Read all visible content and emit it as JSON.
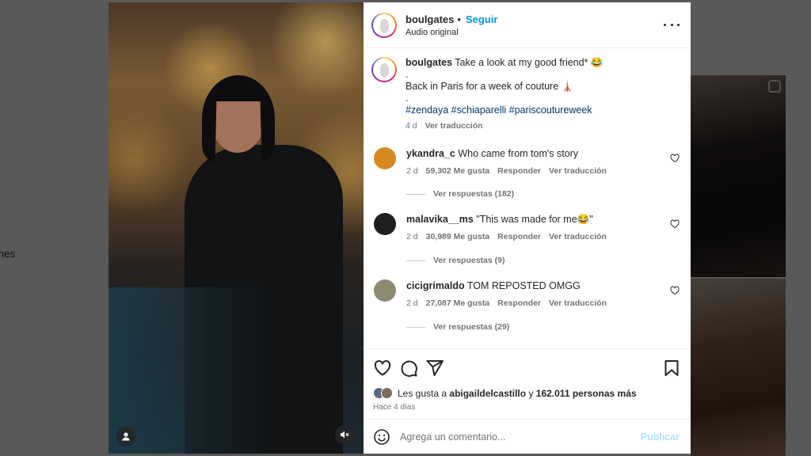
{
  "background": {
    "side_text": "nes"
  },
  "post": {
    "username": "boulgates",
    "separator": "•",
    "follow_label": "Seguir",
    "audio": "Audio original",
    "caption": {
      "username": "boulgates",
      "text_line1": "Take a look at my good friend* 😂",
      "line2": ".",
      "line3": "Back in Paris for a week of couture 🗼",
      "line4": ".",
      "hashtags": "#zendaya #schiaparelli #pariscoutureweek",
      "age": "4 d",
      "translate": "Ver traducción"
    },
    "comments": [
      {
        "username": "ykandra_c",
        "text": "Who came from tom's story",
        "age": "2 d",
        "likes": "59,302 Me gusta",
        "reply": "Responder",
        "translate": "Ver traducción",
        "replies": "Ver respuestas (182)",
        "avatar_color": "#d6891e"
      },
      {
        "username": "malavika__ms",
        "text": "\"This was made for me😂\"",
        "age": "2 d",
        "likes": "30,989 Me gusta",
        "reply": "Responder",
        "translate": "Ver traducción",
        "replies": "Ver respuestas (9)",
        "avatar_color": "#1e1e1e"
      },
      {
        "username": "cicigrimaldo",
        "text": "TOM REPOSTED OMGG",
        "age": "2 d",
        "likes": "27,087 Me gusta",
        "reply": "Responder",
        "translate": "Ver traducción",
        "replies": "Ver respuestas (29)",
        "avatar_color": "#8c8a70"
      }
    ],
    "likes": {
      "prefix": "Les gusta a",
      "user": "abigaildelcastillo",
      "conj": "y",
      "others": "162.011 personas más"
    },
    "time": "Hace 4 días",
    "comment_input": {
      "placeholder": "Agrega un comentario...",
      "value": ""
    },
    "publish_label": "Publicar"
  }
}
